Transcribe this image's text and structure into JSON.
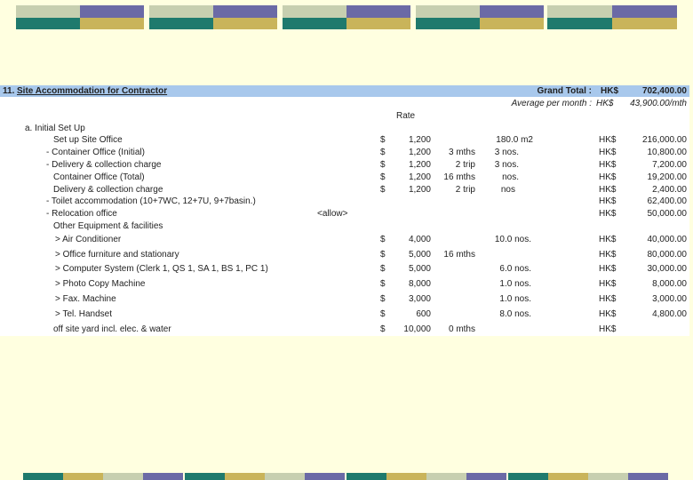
{
  "colors": {
    "background": "#ffffe0",
    "header_bar": "#a8c8ec",
    "deco_purple": "#6b6aa6",
    "deco_teal": "#1f7a6d",
    "deco_olive": "#c9b45a",
    "deco_light": "#c7cfb0"
  },
  "header": {
    "number": "11.",
    "title": "Site Accommodation for Contractor",
    "grand_total_label": "Grand Total :",
    "grand_total_currency": "HK$",
    "grand_total_value": "702,400.00"
  },
  "average": {
    "label": "Average per month :",
    "currency": "HK$",
    "value": "43,900.00/mth"
  },
  "rate_label": "Rate",
  "section_a": "a. Initial Set Up",
  "rows": [
    {
      "desc": "Set up Site Office",
      "sym": "$",
      "rate": "1,200",
      "dur": "",
      "qty": "180.0 m2",
      "cur": "HK$",
      "amt": "216,000.00"
    },
    {
      "desc": "- Container Office (Initial)",
      "sym": "$",
      "rate": "1,200",
      "dur": "3 mths",
      "qty": "3 nos.",
      "cur": "HK$",
      "amt": "10,800.00"
    },
    {
      "desc": "- Delivery & collection charge",
      "sym": "$",
      "rate": "1,200",
      "dur": "2 trip",
      "qty": "3 nos.",
      "cur": "HK$",
      "amt": "7,200.00"
    },
    {
      "desc": "Container Office (Total)",
      "sym": "$",
      "rate": "1,200",
      "dur": "16 mths",
      "qty": "nos.",
      "cur": "HK$",
      "amt": "19,200.00"
    },
    {
      "desc": "Delivery & collection charge",
      "sym": "$",
      "rate": "1,200",
      "dur": "2 trip",
      "qty": "nos",
      "cur": "HK$",
      "amt": "2,400.00"
    },
    {
      "desc": "- Toilet accommodation (10+7WC, 12+7U, 9+7basin.)",
      "sym": "",
      "rate": "",
      "dur": "",
      "qty": "",
      "cur": "HK$",
      "amt": "62,400.00"
    },
    {
      "desc": "- Relocation office",
      "sym": "<allow>",
      "rate": "",
      "dur": "",
      "qty": "",
      "cur": "HK$",
      "amt": "50,000.00"
    },
    {
      "desc": "Other Equipment & facilities",
      "sym": "",
      "rate": "",
      "dur": "",
      "qty": "",
      "cur": "",
      "amt": ""
    },
    {
      "desc": "> Air Conditioner",
      "sym": "$",
      "rate": "4,000",
      "dur": "",
      "qty": "10.0 nos.",
      "cur": "HK$",
      "amt": "40,000.00"
    },
    {
      "desc": "> Office furniture and stationary",
      "sym": "$",
      "rate": "5,000",
      "dur": "16 mths",
      "qty": "",
      "cur": "HK$",
      "amt": "80,000.00"
    },
    {
      "desc": "> Computer System (Clerk 1, QS 1, SA 1, BS 1, PC 1)",
      "sym": "$",
      "rate": "5,000",
      "dur": "",
      "qty": "6.0 nos.",
      "cur": "HK$",
      "amt": "30,000.00"
    },
    {
      "desc": "> Photo Copy Machine",
      "sym": "$",
      "rate": "8,000",
      "dur": "",
      "qty": "1.0 nos.",
      "cur": "HK$",
      "amt": "8,000.00"
    },
    {
      "desc": "> Fax. Machine",
      "sym": "$",
      "rate": "3,000",
      "dur": "",
      "qty": "1.0 nos.",
      "cur": "HK$",
      "amt": "3,000.00"
    },
    {
      "desc": "> Tel. Handset",
      "sym": "$",
      "rate": "600",
      "dur": "",
      "qty": "8.0 nos.",
      "cur": "HK$",
      "amt": "4,800.00"
    },
    {
      "desc": "off site yard incl. elec. & water",
      "sym": "$",
      "rate": "10,000",
      "dur": "0 mths",
      "qty": "",
      "cur": "HK$",
      "amt": ""
    }
  ]
}
